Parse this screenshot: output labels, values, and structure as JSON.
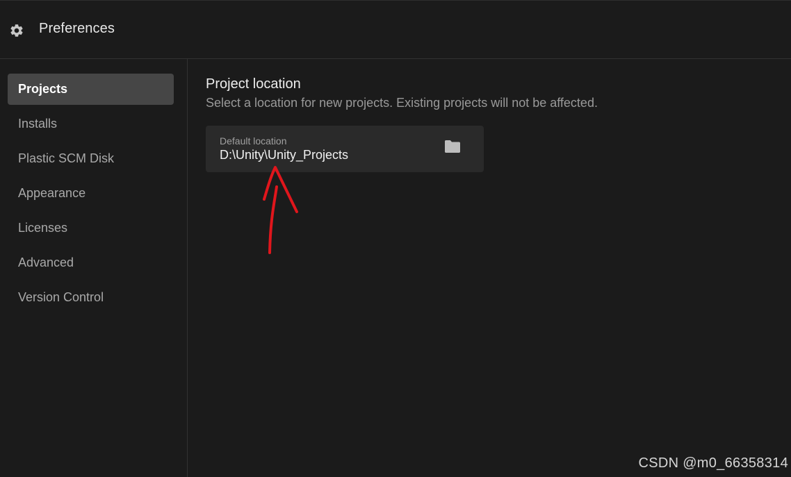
{
  "window": {
    "title": "Preferences",
    "title_icon": "gear-icon"
  },
  "sidebar": {
    "items": [
      {
        "label": "Projects",
        "active": true
      },
      {
        "label": "Installs",
        "active": false
      },
      {
        "label": "Plastic SCM Disk",
        "active": false
      },
      {
        "label": "Appearance",
        "active": false
      },
      {
        "label": "Licenses",
        "active": false
      },
      {
        "label": "Advanced",
        "active": false
      },
      {
        "label": "Version Control",
        "active": false
      }
    ]
  },
  "main": {
    "section_title": "Project location",
    "section_description": "Select a location for new projects. Existing projects will not be affected.",
    "location": {
      "label": "Default location",
      "value": "D:\\Unity\\Unity_Projects",
      "browse_icon": "folder-icon"
    }
  },
  "annotation": {
    "shape": "hand-drawn-arrow",
    "color": "#e0161c"
  },
  "watermark": "CSDN @m0_66358314",
  "colors": {
    "background": "#1b1b1b",
    "active_item": "#464646",
    "card": "#2a2a2a"
  }
}
